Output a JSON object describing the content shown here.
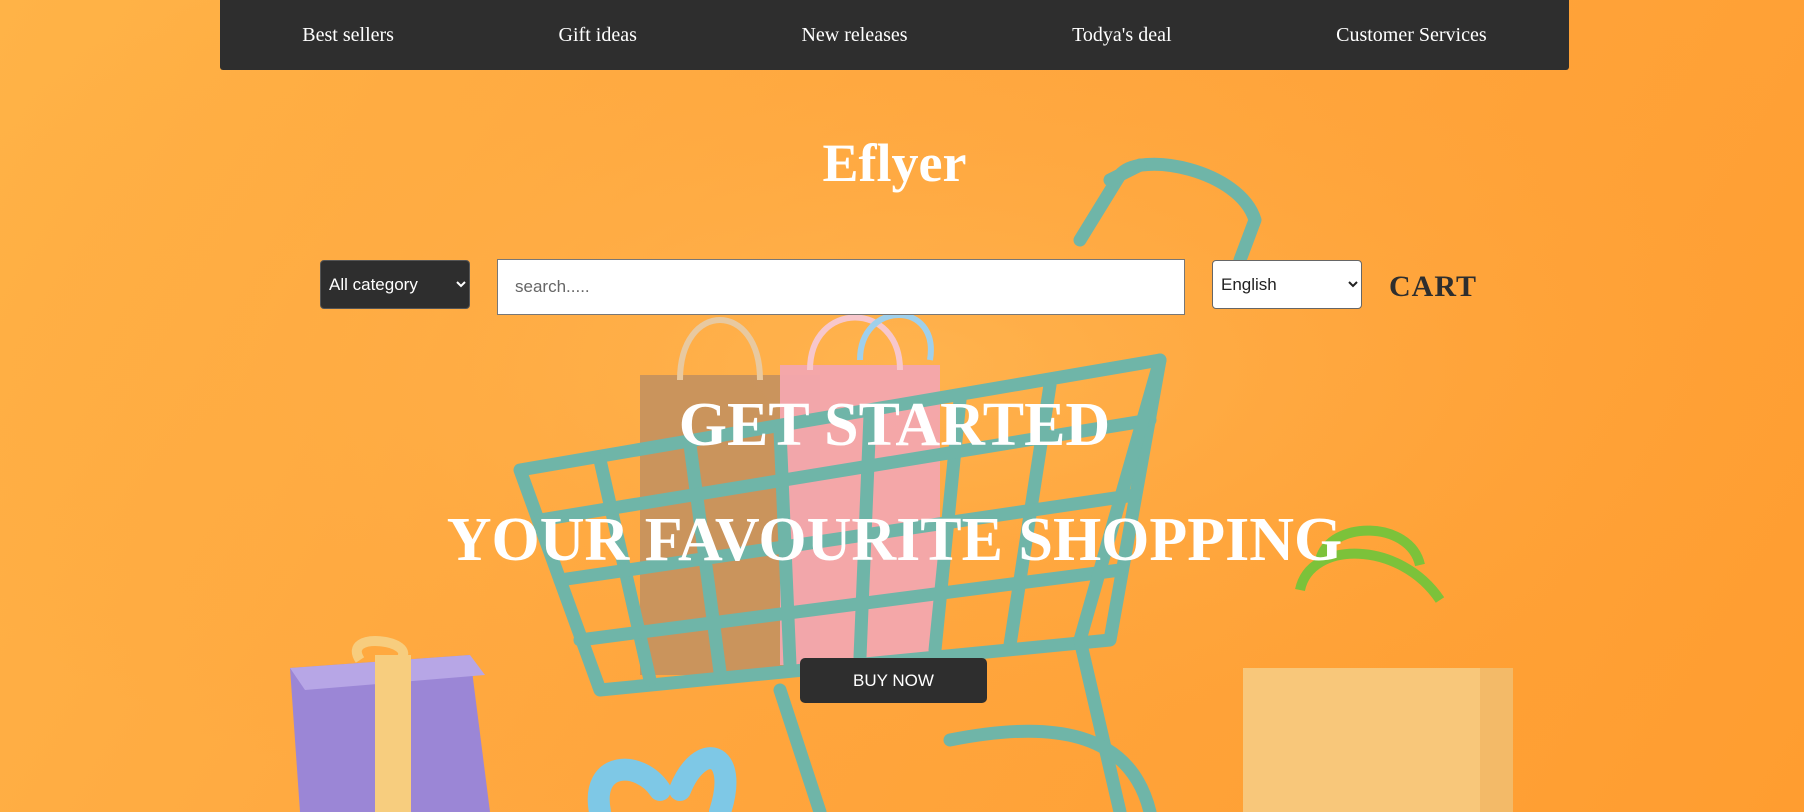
{
  "nav": {
    "items": [
      {
        "label": "Best sellers"
      },
      {
        "label": "Gift ideas"
      },
      {
        "label": "New releases"
      },
      {
        "label": "Todya's deal"
      },
      {
        "label": "Customer Services"
      }
    ]
  },
  "brand": {
    "name": "Eflyer"
  },
  "search": {
    "category": {
      "selected": "All category"
    },
    "placeholder": "search.....",
    "language": {
      "selected": "English"
    },
    "cart_label": "CART"
  },
  "hero": {
    "line1": "GET STARTED",
    "line2": "YOUR FAVOURITE SHOPPING",
    "button_label": "BUY NOW"
  },
  "colors": {
    "background": "#ffa73f",
    "nav_bg": "#2e2e2e",
    "text_light": "#ffffff",
    "cart_teal": "#6fb5a8",
    "bag_brown": "#c7925e",
    "bag_pink": "#f3a6ae",
    "gift_purple": "#9b86d6",
    "ribbon_yellow": "#f7cd7e",
    "bag_yellow": "#f8c77a",
    "handle_green": "#7cc23a",
    "ribbon_blue": "#7ec8e6"
  },
  "illustration": {
    "description_icons": [
      "shopping-cart-icon",
      "shopping-bag-icon",
      "gift-box-icon"
    ]
  }
}
